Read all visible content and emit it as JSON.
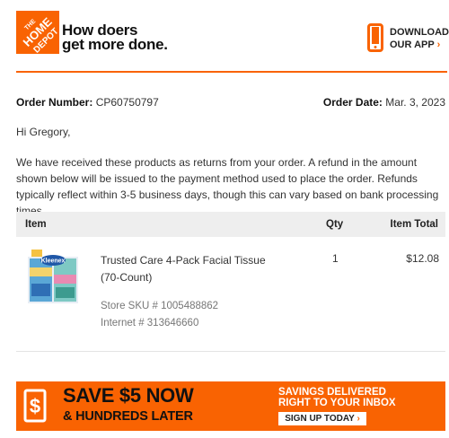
{
  "brand": {
    "logo_text": "THE HOME DEPOT",
    "tagline_line1": "How doers",
    "tagline_line2": "get more done.",
    "color": "#f96302"
  },
  "app_link": {
    "line1": "DOWNLOAD",
    "line2": "OUR APP",
    "chevron": "›",
    "icon": "phone-icon"
  },
  "order": {
    "number_label": "Order Number:",
    "number_value": "CP60750797",
    "date_label": "Order Date:",
    "date_value": "Mar. 3, 2023"
  },
  "greeting": "Hi Gregory,",
  "message": "We have received these products as returns from your order. A refund in the amount shown below will be issued to the payment method used to place the order. Refunds typically reflect within 3-5 business days, though this can vary based on bank processing times.",
  "table": {
    "headers": {
      "item": "Item",
      "qty": "Qty",
      "total": "Item Total"
    },
    "rows": [
      {
        "name": "Trusted Care 4-Pack Facial Tissue (70-Count)",
        "qty": "1",
        "total": "$12.08",
        "sku": "Store SKU # 1005488862",
        "internet": "Internet # 313646660",
        "image": "tissue-box-image"
      }
    ]
  },
  "promo": {
    "headline1": "SAVE $5 NOW",
    "headline2": "& HUNDREDS LATER",
    "sub_line1": "SAVINGS DELIVERED",
    "sub_line2": "RIGHT TO YOUR INBOX",
    "cta": "SIGN UP TODAY",
    "cta_chevron": "›",
    "icon": "dollar-icon"
  }
}
